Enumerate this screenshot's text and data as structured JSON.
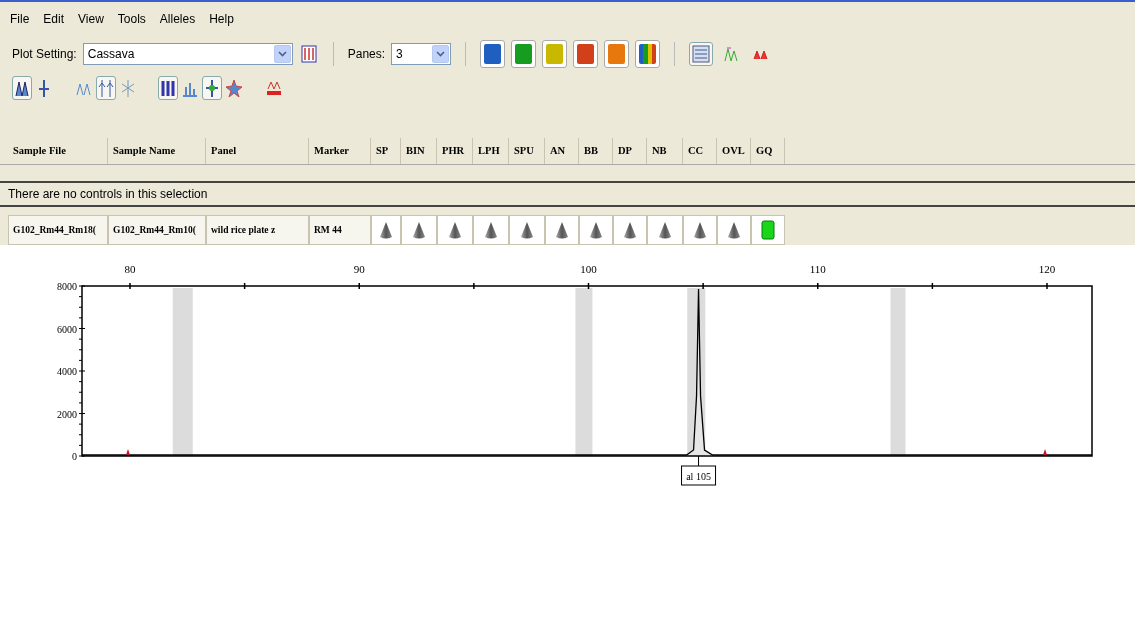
{
  "menu": [
    "File",
    "Edit",
    "View",
    "Tools",
    "Alleles",
    "Help"
  ],
  "toolbar": {
    "plot_setting_label": "Plot Setting:",
    "plot_setting_value": "Cassava",
    "panes_label": "Panes:",
    "panes_value": "3",
    "color_buttons": [
      {
        "kind": "solid",
        "color": "#1f5fbf"
      },
      {
        "kind": "solid",
        "color": "#169c1e"
      },
      {
        "kind": "solid",
        "color": "#c9b800"
      },
      {
        "kind": "solid",
        "color": "#d2401a"
      },
      {
        "kind": "solid",
        "color": "#e6780e"
      },
      {
        "kind": "multi"
      }
    ],
    "view_buttons": [
      {
        "selected": true
      },
      {
        "selected": false
      },
      {
        "selected": false
      }
    ]
  },
  "toolbar2": [
    [
      {
        "selected": true
      },
      {
        "selected": false
      }
    ],
    [
      {
        "selected": false
      },
      {
        "selected": true
      },
      {
        "selected": false
      }
    ],
    [
      {
        "selected": true
      },
      {
        "selected": false
      },
      {
        "selected": true
      },
      {
        "selected": false
      }
    ],
    [
      {
        "selected": false
      }
    ]
  ],
  "table": {
    "columns": [
      "Sample File",
      "Sample Name",
      "Panel",
      "Marker",
      "SP",
      "BIN",
      "PHR",
      "LPH",
      "SPU",
      "AN",
      "BB",
      "DP",
      "NB",
      "CC",
      "OVL",
      "GQ"
    ],
    "message": "There are no controls in this selection",
    "rows": [
      {
        "cells": [
          "G102_Rm44_Rm18(",
          "G102_Rm44_Rm10(",
          "wild rice plate z",
          "RM 44"
        ],
        "flags": [
          {
            "kind": "neutral"
          },
          {
            "kind": "neutral"
          },
          {
            "kind": "neutral"
          },
          {
            "kind": "neutral"
          },
          {
            "kind": "neutral"
          },
          {
            "kind": "neutral"
          },
          {
            "kind": "neutral"
          },
          {
            "kind": "neutral"
          },
          {
            "kind": "neutral"
          },
          {
            "kind": "neutral"
          },
          {
            "kind": "neutral"
          },
          {
            "kind": "pass"
          }
        ]
      }
    ]
  },
  "plot": {
    "xticks": [
      "80",
      "90",
      "100",
      "110",
      "120"
    ],
    "yticks": [
      "8000",
      "6000",
      "4000",
      "2000",
      "0"
    ],
    "allele_label": "al 105"
  }
}
